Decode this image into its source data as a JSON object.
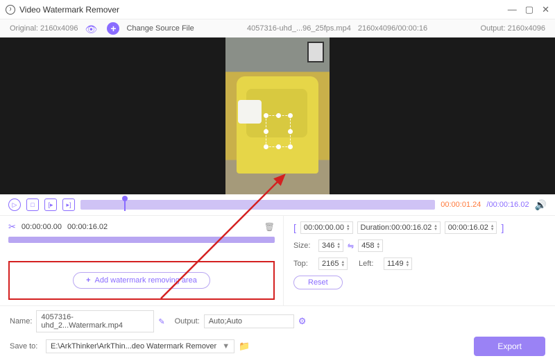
{
  "title": "Video Watermark Remover",
  "infobar": {
    "original": "Original: 2160x4096",
    "change": "Change Source File",
    "filename": "4057316-uhd_...96_25fps.mp4",
    "resolution": "2160x4096/00:00:16",
    "output": "Output: 2160x4096"
  },
  "timeline": {
    "current": "00:00:01.24",
    "duration": "/00:00:16.02"
  },
  "clip": {
    "in": "00:00:00.00",
    "out": "00:00:16.02"
  },
  "range": {
    "start": "00:00:00.00",
    "durlabel": "Duration:00:00:16.02",
    "end": "00:00:16.02"
  },
  "size": {
    "label": "Size:",
    "w": "346",
    "h": "458"
  },
  "pos": {
    "tlabel": "Top:",
    "t": "2165",
    "llabel": "Left:",
    "l": "1149"
  },
  "reset": "Reset",
  "addarea": "Add watermark removing area",
  "bottom": {
    "nameLabel": "Name:",
    "name": "4057316-uhd_2...Watermark.mp4",
    "outLabel": "Output:",
    "out": "Auto;Auto",
    "saveLabel": "Save to:",
    "save": "E:\\ArkThinker\\ArkThin...deo Watermark Remover",
    "export": "Export"
  }
}
